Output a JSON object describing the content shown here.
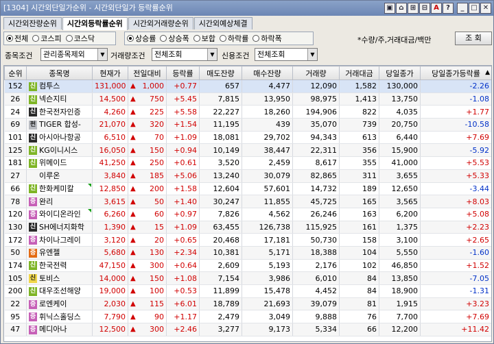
{
  "window": {
    "title": "[1304] 시간외단일가순위 - 시간외단일가 등락률순위",
    "buttons": [
      "▣",
      "⌂",
      "⊞",
      "⊟",
      "A",
      "?",
      "_",
      "□",
      "✕"
    ]
  },
  "tabs": [
    "시간외잔량순위",
    "시간외등락률순위",
    "시간외거래량순위",
    "시간외예상체결"
  ],
  "active_tab": 1,
  "market_radios": [
    {
      "label": "전체",
      "checked": true
    },
    {
      "label": "코스피",
      "checked": false
    },
    {
      "label": "코스닥",
      "checked": false
    }
  ],
  "sort_radios": [
    {
      "label": "상승률",
      "checked": true
    },
    {
      "label": "상승폭",
      "checked": false
    },
    {
      "label": "보합",
      "checked": false
    },
    {
      "label": "하락률",
      "checked": false
    },
    {
      "label": "하락폭",
      "checked": false
    }
  ],
  "note": "*수량/주,거래대금/백만",
  "query_button": "조 회",
  "filters": {
    "stock_cond_label": "종목조건",
    "stock_cond_value": "관리종목제외",
    "volume_cond_label": "거래량조건",
    "volume_cond_value": "전체조회",
    "credit_cond_label": "신용조건",
    "credit_cond_value": "전체조회"
  },
  "columns": [
    "순위",
    "종목명",
    "현재가",
    "전일대비",
    "등락률",
    "매도잔량",
    "매수잔량",
    "거래량",
    "거래대금",
    "당일종가",
    "당일종가등락률"
  ],
  "rows": [
    {
      "rank": "152",
      "badge": "신",
      "bc": "g",
      "name": "컴투스",
      "price": "131,000",
      "diff": "1,000",
      "rate": "+0.77",
      "sell": "657",
      "buy": "4,477",
      "vol": "12,090",
      "amt": "1,582",
      "close": "130,000",
      "crate": "-2.26",
      "tri": false
    },
    {
      "rank": "26",
      "badge": "신",
      "bc": "g",
      "name": "넥슨지티",
      "price": "14,500",
      "diff": "750",
      "rate": "+5.45",
      "sell": "7,815",
      "buy": "13,950",
      "vol": "98,975",
      "amt": "1,413",
      "close": "13,750",
      "crate": "-1.08",
      "tri": false
    },
    {
      "rank": "24",
      "badge": "신",
      "bc": "d",
      "name": "한국전자인증",
      "price": "4,260",
      "diff": "225",
      "rate": "+5.58",
      "sell": "22,227",
      "buy": "18,260",
      "vol": "194,906",
      "amt": "822",
      "close": "4,035",
      "crate": "+1.77",
      "tri": false
    },
    {
      "rank": "69",
      "badge": "펀",
      "bc": "s",
      "name": "TIGER 합성-",
      "price": "21,070",
      "diff": "320",
      "rate": "+1.54",
      "sell": "11,195",
      "buy": "439",
      "vol": "35,070",
      "amt": "739",
      "close": "20,750",
      "crate": "-10.58",
      "tri": false
    },
    {
      "rank": "101",
      "badge": "신",
      "bc": "d",
      "name": "아시아나항공",
      "price": "6,510",
      "diff": "70",
      "rate": "+1.09",
      "sell": "18,081",
      "buy": "29,702",
      "vol": "94,343",
      "amt": "613",
      "close": "6,440",
      "crate": "+7.69",
      "tri": false
    },
    {
      "rank": "125",
      "badge": "신",
      "bc": "g",
      "name": "KG이니시스",
      "price": "16,050",
      "diff": "150",
      "rate": "+0.94",
      "sell": "10,149",
      "buy": "38,447",
      "vol": "22,311",
      "amt": "356",
      "close": "15,900",
      "crate": "-5.92",
      "tri": false
    },
    {
      "rank": "181",
      "badge": "신",
      "bc": "g",
      "name": "위메이드",
      "price": "41,250",
      "diff": "250",
      "rate": "+0.61",
      "sell": "3,520",
      "buy": "2,459",
      "vol": "8,617",
      "amt": "355",
      "close": "41,000",
      "crate": "+5.53",
      "tri": false
    },
    {
      "rank": "27",
      "badge": "",
      "bc": "",
      "name": "이루온",
      "price": "3,840",
      "diff": "185",
      "rate": "+5.06",
      "sell": "13,240",
      "buy": "30,079",
      "vol": "82,865",
      "amt": "311",
      "close": "3,655",
      "crate": "+5.33",
      "tri": false
    },
    {
      "rank": "66",
      "badge": "신",
      "bc": "g",
      "name": "한화케미칼",
      "price": "12,850",
      "diff": "200",
      "rate": "+1.58",
      "sell": "12,604",
      "buy": "57,601",
      "vol": "14,732",
      "amt": "189",
      "close": "12,650",
      "crate": "-3.44",
      "tri": true
    },
    {
      "rank": "78",
      "badge": "증",
      "bc": "p",
      "name": "완리",
      "price": "3,615",
      "diff": "50",
      "rate": "+1.40",
      "sell": "30,247",
      "buy": "11,855",
      "vol": "45,725",
      "amt": "165",
      "close": "3,565",
      "crate": "+8.03",
      "tri": false
    },
    {
      "rank": "120",
      "badge": "증",
      "bc": "p",
      "name": "와이디온라인",
      "price": "6,260",
      "diff": "60",
      "rate": "+0.97",
      "sell": "7,826",
      "buy": "4,562",
      "vol": "26,246",
      "amt": "163",
      "close": "6,200",
      "crate": "+5.08",
      "tri": true
    },
    {
      "rank": "130",
      "badge": "신",
      "bc": "d",
      "name": "SH에너지화학",
      "price": "1,390",
      "diff": "15",
      "rate": "+1.09",
      "sell": "63,455",
      "buy": "126,738",
      "vol": "115,925",
      "amt": "161",
      "close": "1,375",
      "crate": "+2.23",
      "tri": false
    },
    {
      "rank": "172",
      "badge": "증",
      "bc": "p",
      "name": "차이나그레이",
      "price": "3,120",
      "diff": "20",
      "rate": "+0.65",
      "sell": "20,468",
      "buy": "17,181",
      "vol": "50,730",
      "amt": "158",
      "close": "3,100",
      "crate": "+2.65",
      "tri": false
    },
    {
      "rank": "50",
      "badge": "증",
      "bc": "o",
      "name": "유엔젤",
      "price": "5,680",
      "diff": "130",
      "rate": "+2.34",
      "sell": "10,381",
      "buy": "5,171",
      "vol": "18,388",
      "amt": "104",
      "close": "5,550",
      "crate": "-1.60",
      "tri": false
    },
    {
      "rank": "174",
      "badge": "신",
      "bc": "g",
      "name": "한국전력",
      "price": "47,150",
      "diff": "300",
      "rate": "+0.64",
      "sell": "2,609",
      "buy": "5,193",
      "vol": "2,176",
      "amt": "102",
      "close": "46,850",
      "crate": "+1.52",
      "tri": false
    },
    {
      "rank": "105",
      "badge": "신",
      "bc": "y",
      "name": "토비스",
      "price": "14,000",
      "diff": "150",
      "rate": "+1.08",
      "sell": "7,154",
      "buy": "3,986",
      "vol": "6,010",
      "amt": "84",
      "close": "13,850",
      "crate": "-7.05",
      "tri": false
    },
    {
      "rank": "200",
      "badge": "신",
      "bc": "g",
      "name": "대우조선해양",
      "price": "19,000",
      "diff": "100",
      "rate": "+0.53",
      "sell": "11,899",
      "buy": "15,478",
      "vol": "4,452",
      "amt": "84",
      "close": "18,900",
      "crate": "-1.31",
      "tri": false
    },
    {
      "rank": "22",
      "badge": "증",
      "bc": "p",
      "name": "로엔케이",
      "price": "2,030",
      "diff": "115",
      "rate": "+6.01",
      "sell": "18,789",
      "buy": "21,693",
      "vol": "39,079",
      "amt": "81",
      "close": "1,915",
      "crate": "+3.23",
      "tri": false
    },
    {
      "rank": "95",
      "badge": "증",
      "bc": "p",
      "name": "휘닉스홀딩스",
      "price": "7,790",
      "diff": "90",
      "rate": "+1.17",
      "sell": "2,479",
      "buy": "3,049",
      "vol": "9,888",
      "amt": "76",
      "close": "7,700",
      "crate": "+7.69",
      "tri": false
    },
    {
      "rank": "47",
      "badge": "증",
      "bc": "p",
      "name": "메디아나",
      "price": "12,500",
      "diff": "300",
      "rate": "+2.46",
      "sell": "3,277",
      "buy": "9,173",
      "vol": "5,334",
      "amt": "66",
      "close": "12,200",
      "crate": "+11.42",
      "tri": false
    }
  ]
}
